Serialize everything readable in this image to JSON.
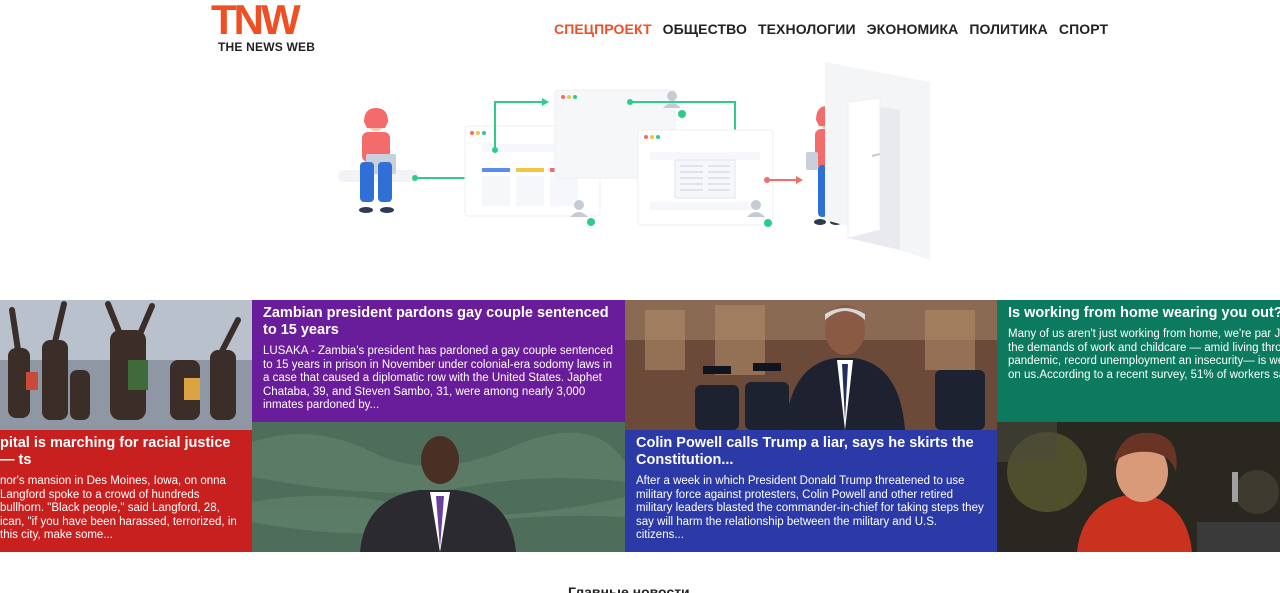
{
  "header": {
    "logo_mark": "TNW",
    "logo_sub": "THE NEWS WEB",
    "nav": [
      {
        "label": "СПЕЦПРОЕКТ",
        "active": true
      },
      {
        "label": "ОБЩЕСТВО",
        "active": false
      },
      {
        "label": "ТЕХНОЛОГИИ",
        "active": false
      },
      {
        "label": "ЭКОНОМИКА",
        "active": false
      },
      {
        "label": "ПОЛИТИКА",
        "active": false
      },
      {
        "label": "СПОРТ",
        "active": false
      }
    ]
  },
  "colors": {
    "accent": "#f04e23",
    "red_tile": "#c8201f",
    "purple_tile": "#6a1d9a",
    "blue_tile": "#2c3aa8",
    "teal_tile": "#0c7a5e",
    "illustration_green": "#2ecc8a"
  },
  "tiles": [
    {
      "headline": "pital is marching for racial justice — ts",
      "summary": "nor's mansion in Des Moines, Iowa, on onna Langford spoke to a crowd of hundreds bullhorn. \"Black people,\" said Langford, 28, ican, \"if you have been harassed, terrorized, in this city, make some..."
    },
    {
      "headline": "Zambian president pardons gay couple sentenced to 15 years",
      "summary": "LUSAKA - Zambia's president has pardoned a gay couple sentenced to 15 years in prison in November under colonial-era sodomy laws in a case that caused a diplomatic row with the United States. Japhet Chataba, 39, and Steven Sambo, 31, were among nearly 3,000 inmates pardoned by..."
    },
    {
      "headline": "Colin Powell calls Trump a liar, says he skirts the Constitution...",
      "summary": "After a week in which President Donald Trump threatened to use military force against protesters, Colin Powell and other retired military leaders blasted the commander-in-chief for taking steps they say will harm the relationship between the military and U.S. citizens..."
    },
    {
      "headline": "Is working from home wearing you out? Do avoid burnout",
      "summary": "Many of us aren't just working from home, we're par Juggling the demands of work and childcare — amid living through a pandemic, record unemployment an insecurity— is weighing on us.According to a recent survey, 51% of workers said..."
    }
  ],
  "section_title": "Главные новости"
}
